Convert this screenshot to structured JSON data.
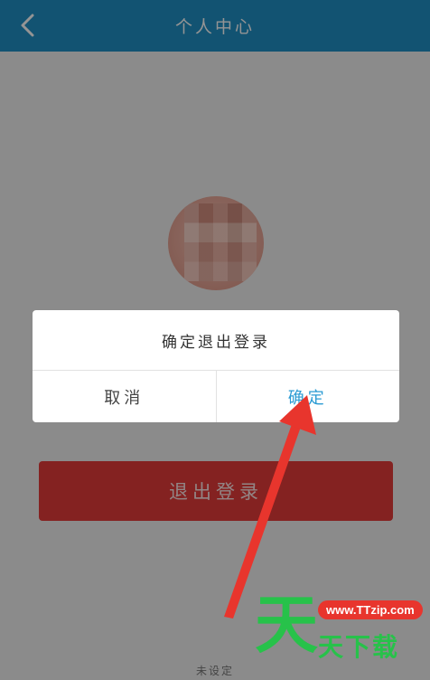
{
  "header": {
    "title": "个人中心",
    "back_icon": "chevron-left-icon"
  },
  "main": {
    "logout_label": "退出登录",
    "bottom_hint": "未设定"
  },
  "dialog": {
    "message": "确定退出登录",
    "cancel_label": "取消",
    "confirm_label": "确定"
  },
  "annotation": {
    "arrow_color": "#e8352d"
  },
  "watermark": {
    "char": "天",
    "url": "www.TTzip.com",
    "name": "天下载"
  },
  "colors": {
    "header_bg": "#1f8fc4",
    "logout_bg": "#e33b3a",
    "confirm_text": "#2b9bd3"
  }
}
